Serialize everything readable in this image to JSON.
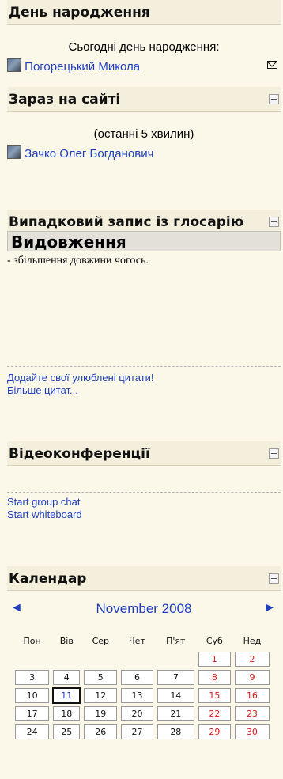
{
  "birthday": {
    "title": "День народження",
    "intro": "Сьогодні день народження:",
    "person": "Погорецький Микола"
  },
  "online": {
    "title": "Зараз на сайті",
    "period": "(останні 5 хвилин)",
    "user": "Зачко Олег Богданович"
  },
  "glossary": {
    "title": "Випадковий запис із глосарію",
    "term": "Видовження",
    "definition": "- збільшення довжини чогось.",
    "add_link": "Додайте свої улюблені цитати!",
    "more_link": "Більше цитат..."
  },
  "video": {
    "title": "Відеоконференції",
    "group_chat": "Start group chat",
    "whiteboard": "Start whiteboard"
  },
  "calendar": {
    "title": "Календар",
    "month": "November 2008",
    "prev_icon": "arrow-left-icon",
    "next_icon": "arrow-right-icon",
    "weekdays": [
      "Пон",
      "Вів",
      "Сер",
      "Чет",
      "П'ят",
      "Суб",
      "Нед"
    ],
    "weeks": [
      [
        "",
        "",
        "",
        "",
        "",
        "1",
        "2"
      ],
      [
        "3",
        "4",
        "5",
        "6",
        "7",
        "8",
        "9"
      ],
      [
        "10",
        "11",
        "12",
        "13",
        "14",
        "15",
        "16"
      ],
      [
        "17",
        "18",
        "19",
        "20",
        "21",
        "22",
        "23"
      ],
      [
        "24",
        "25",
        "26",
        "27",
        "28",
        "29",
        "30"
      ]
    ],
    "today": "11",
    "weekend_color": "#e01919",
    "link_color": "#1f3fbf"
  }
}
